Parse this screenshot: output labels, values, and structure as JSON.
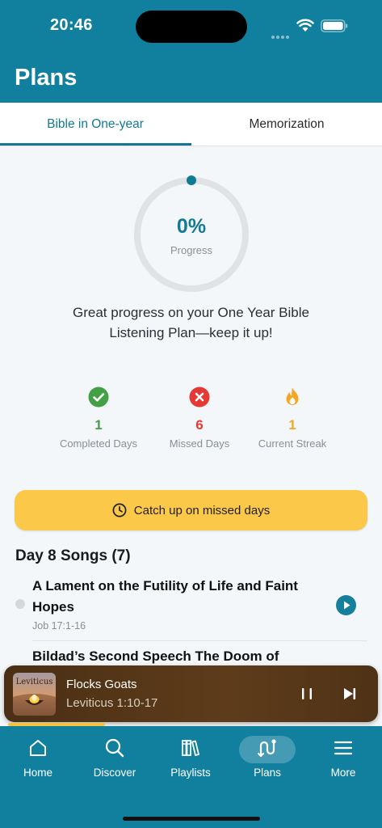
{
  "status_bar": {
    "time": "20:46"
  },
  "header": {
    "title": "Plans"
  },
  "tabs": [
    {
      "label": "Bible in One-year",
      "active": true
    },
    {
      "label": "Memorization",
      "active": false
    }
  ],
  "progress": {
    "percent_text": "0%",
    "label": "Progress",
    "fraction": 0,
    "message": "Great progress on your One Year Bible Listening Plan—keep it up!"
  },
  "stats": [
    {
      "icon": "check-circle-icon",
      "value": "1",
      "label": "Completed Days",
      "color": "#43a047"
    },
    {
      "icon": "x-circle-icon",
      "value": "6",
      "label": "Missed Days",
      "color": "#e53935"
    },
    {
      "icon": "flame-icon",
      "value": "1",
      "label": "Current Streak",
      "color": "#f5a623"
    }
  ],
  "catch_up": {
    "label": "Catch up on missed days",
    "icon": "clock-icon"
  },
  "songs": {
    "heading": "Day 8 Songs (7)",
    "items": [
      {
        "title": "A Lament on the Futility of Life and Faint Hopes",
        "reference": "Job 17:1-16"
      },
      {
        "title": "Bildad’s Second Speech The Doom of"
      }
    ]
  },
  "now_playing": {
    "artwork_text": "Leviticus",
    "title": "Flocks Goats",
    "reference": "Leviticus 1:10-17",
    "is_playing": true
  },
  "bottom_nav": [
    {
      "label": "Home",
      "icon": "home-icon",
      "active": false
    },
    {
      "label": "Discover",
      "icon": "search-icon",
      "active": false
    },
    {
      "label": "Playlists",
      "icon": "books-icon",
      "active": false
    },
    {
      "label": "Plans",
      "icon": "route-icon",
      "active": true
    },
    {
      "label": "More",
      "icon": "menu-icon",
      "active": false
    }
  ],
  "colors": {
    "brand": "#117f9e",
    "accent_yellow": "#fcc84a",
    "completed": "#43a047",
    "missed": "#e53935",
    "streak": "#f5a623"
  }
}
